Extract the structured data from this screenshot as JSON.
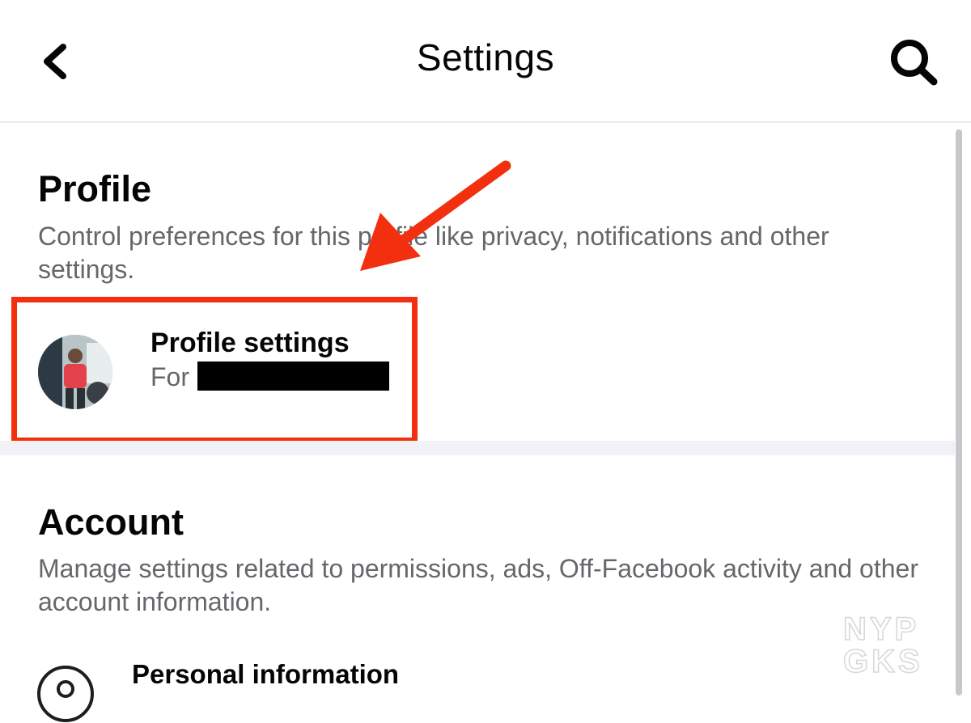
{
  "header": {
    "title": "Settings",
    "back_icon": "chevron-left-icon",
    "search_icon": "search-icon"
  },
  "profile_section": {
    "title": "Profile",
    "description": "Control preferences for this profile like privacy, notifications and other settings."
  },
  "profile_settings": {
    "label": "Profile settings",
    "sub_prefix": "For",
    "avatar_icon": "profile-avatar"
  },
  "account_section": {
    "title": "Account",
    "description": "Manage settings related to permissions, ads, Off-Facebook activity and other account information."
  },
  "personal_information": {
    "label": "Personal information",
    "icon": "user-circle-icon"
  },
  "annotation": {
    "highlight_color": "#f2300f"
  },
  "watermark": {
    "text": "NYP GKS"
  }
}
